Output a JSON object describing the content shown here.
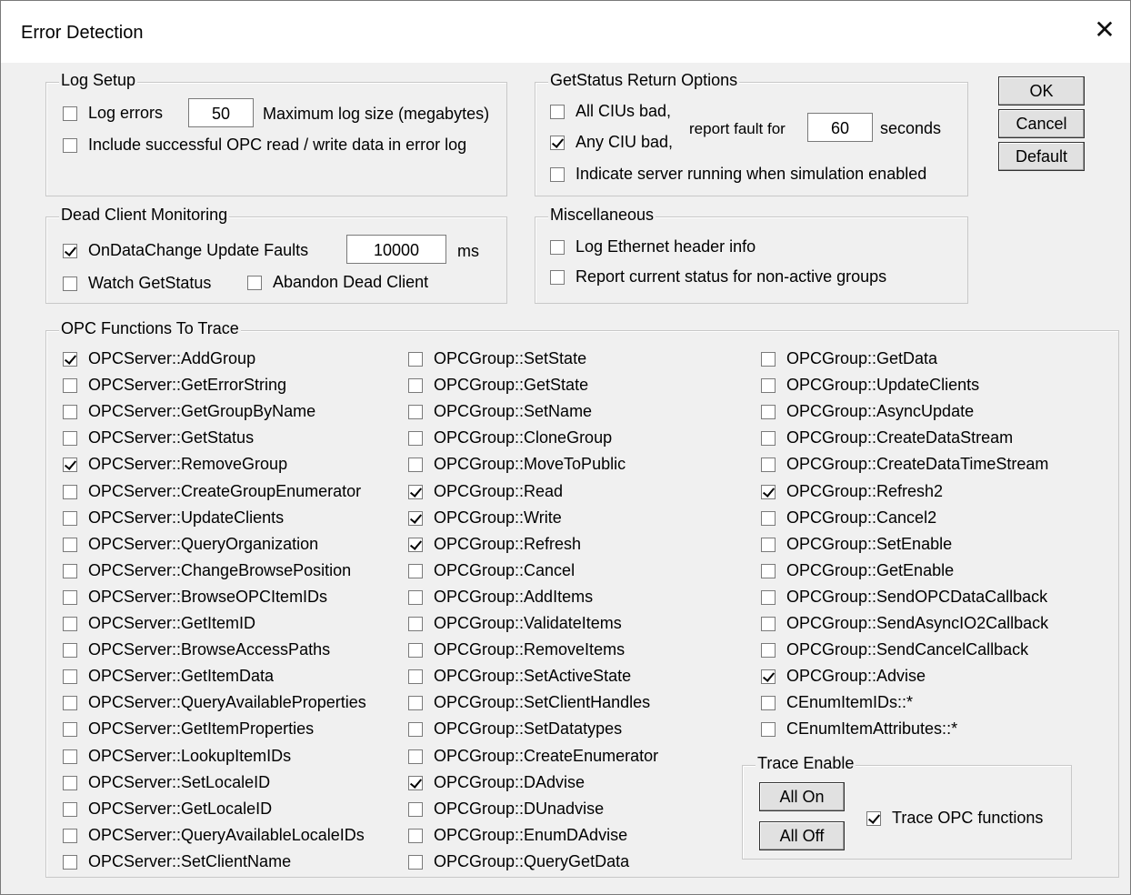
{
  "window": {
    "title": "Error Detection",
    "close_glyph": "✕"
  },
  "log_setup": {
    "title": "Log Setup",
    "log_errors": {
      "label": "Log errors",
      "checked": false
    },
    "log_size_value": "50",
    "log_size_label": "Maximum log size (megabytes)",
    "include_success": {
      "label": "Include successful OPC read / write data in error log",
      "checked": false
    }
  },
  "getstatus": {
    "title": "GetStatus Return Options",
    "all_cius_bad": {
      "label": "All CIUs bad,",
      "checked": false
    },
    "any_ciu_bad": {
      "label": "Any CIU bad,",
      "checked": true
    },
    "report_label": "report fault for",
    "seconds_value": "60",
    "seconds_label": "seconds",
    "indicate_running": {
      "label": "Indicate server running when simulation enabled",
      "checked": false
    }
  },
  "buttons": {
    "ok": "OK",
    "cancel": "Cancel",
    "default": "Default"
  },
  "dead_client": {
    "title": "Dead Client Monitoring",
    "ondatachange": {
      "label": "OnDataChange Update Faults",
      "checked": true
    },
    "ms_value": "10000",
    "ms_label": "ms",
    "watch_getstatus": {
      "label": "Watch GetStatus",
      "checked": false
    },
    "abandon": {
      "label": "Abandon Dead Client",
      "checked": false
    }
  },
  "misc": {
    "title": "Miscellaneous",
    "log_ethernet": {
      "label": "Log Ethernet header info",
      "checked": false
    },
    "report_status": {
      "label": "Report current status for non-active groups",
      "checked": false
    }
  },
  "trace": {
    "title": "OPC Functions To Trace",
    "col1": [
      {
        "label": "OPCServer::AddGroup",
        "checked": true
      },
      {
        "label": "OPCServer::GetErrorString",
        "checked": false
      },
      {
        "label": "OPCServer::GetGroupByName",
        "checked": false
      },
      {
        "label": "OPCServer::GetStatus",
        "checked": false
      },
      {
        "label": "OPCServer::RemoveGroup",
        "checked": true
      },
      {
        "label": "OPCServer::CreateGroupEnumerator",
        "checked": false
      },
      {
        "label": "OPCServer::UpdateClients",
        "checked": false
      },
      {
        "label": "OPCServer::QueryOrganization",
        "checked": false
      },
      {
        "label": "OPCServer::ChangeBrowsePosition",
        "checked": false
      },
      {
        "label": "OPCServer::BrowseOPCItemIDs",
        "checked": false
      },
      {
        "label": "OPCServer::GetItemID",
        "checked": false
      },
      {
        "label": "OPCServer::BrowseAccessPaths",
        "checked": false
      },
      {
        "label": "OPCServer::GetItemData",
        "checked": false
      },
      {
        "label": "OPCServer::QueryAvailableProperties",
        "checked": false
      },
      {
        "label": "OPCServer::GetItemProperties",
        "checked": false
      },
      {
        "label": "OPCServer::LookupItemIDs",
        "checked": false
      },
      {
        "label": "OPCServer::SetLocaleID",
        "checked": false
      },
      {
        "label": "OPCServer::GetLocaleID",
        "checked": false
      },
      {
        "label": "OPCServer::QueryAvailableLocaleIDs",
        "checked": false
      },
      {
        "label": "OPCServer::SetClientName",
        "checked": false
      }
    ],
    "col2": [
      {
        "label": "OPCGroup::SetState",
        "checked": false
      },
      {
        "label": "OPCGroup::GetState",
        "checked": false
      },
      {
        "label": "OPCGroup::SetName",
        "checked": false
      },
      {
        "label": "OPCGroup::CloneGroup",
        "checked": false
      },
      {
        "label": "OPCGroup::MoveToPublic",
        "checked": false
      },
      {
        "label": "OPCGroup::Read",
        "checked": true
      },
      {
        "label": "OPCGroup::Write",
        "checked": true
      },
      {
        "label": "OPCGroup::Refresh",
        "checked": true
      },
      {
        "label": "OPCGroup::Cancel",
        "checked": false
      },
      {
        "label": "OPCGroup::AddItems",
        "checked": false
      },
      {
        "label": "OPCGroup::ValidateItems",
        "checked": false
      },
      {
        "label": "OPCGroup::RemoveItems",
        "checked": false
      },
      {
        "label": "OPCGroup::SetActiveState",
        "checked": false
      },
      {
        "label": "OPCGroup::SetClientHandles",
        "checked": false
      },
      {
        "label": "OPCGroup::SetDatatypes",
        "checked": false
      },
      {
        "label": "OPCGroup::CreateEnumerator",
        "checked": false
      },
      {
        "label": "OPCGroup::DAdvise",
        "checked": true
      },
      {
        "label": "OPCGroup::DUnadvise",
        "checked": false
      },
      {
        "label": "OPCGroup::EnumDAdvise",
        "checked": false
      },
      {
        "label": "OPCGroup::QueryGetData",
        "checked": false
      }
    ],
    "col3": [
      {
        "label": "OPCGroup::GetData",
        "checked": false
      },
      {
        "label": "OPCGroup::UpdateClients",
        "checked": false
      },
      {
        "label": "OPCGroup::AsyncUpdate",
        "checked": false
      },
      {
        "label": "OPCGroup::CreateDataStream",
        "checked": false
      },
      {
        "label": "OPCGroup::CreateDataTimeStream",
        "checked": false
      },
      {
        "label": "OPCGroup::Refresh2",
        "checked": true
      },
      {
        "label": "OPCGroup::Cancel2",
        "checked": false
      },
      {
        "label": "OPCGroup::SetEnable",
        "checked": false
      },
      {
        "label": "OPCGroup::GetEnable",
        "checked": false
      },
      {
        "label": "OPCGroup::SendOPCDataCallback",
        "checked": false
      },
      {
        "label": "OPCGroup::SendAsyncIO2Callback",
        "checked": false
      },
      {
        "label": "OPCGroup::SendCancelCallback",
        "checked": false
      },
      {
        "label": "OPCGroup::Advise",
        "checked": true
      },
      {
        "label": "CEnumItemIDs::*",
        "checked": false
      },
      {
        "label": "CEnumItemAttributes::*",
        "checked": false
      }
    ]
  },
  "trace_enable": {
    "title": "Trace Enable",
    "all_on": "All On",
    "all_off": "All Off",
    "trace_opc": {
      "label": "Trace OPC functions",
      "checked": true
    }
  }
}
